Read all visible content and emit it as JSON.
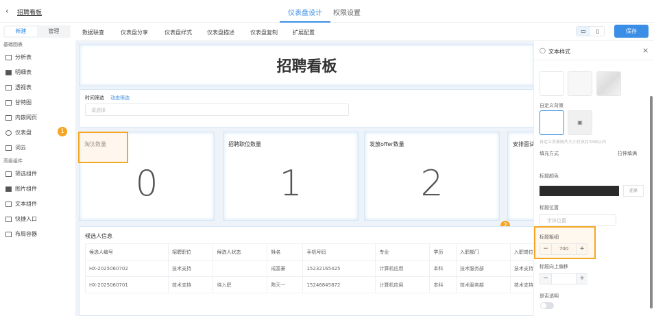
{
  "header": {
    "title": "招聘看板",
    "tabs": [
      "仪表盘设计",
      "权限设置"
    ]
  },
  "sidebar": {
    "seg": [
      "新建",
      "管理"
    ],
    "groups": [
      {
        "label": "基础图表",
        "items": [
          "分析表",
          "明细表",
          "透视表",
          "甘特图",
          "内嵌网页",
          "仪表盘",
          "词云"
        ]
      },
      {
        "label": "高级组件",
        "items": [
          "筛选组件",
          "图片组件",
          "文本组件",
          "快捷入口",
          "布局容器"
        ]
      }
    ]
  },
  "toolbar": {
    "items": [
      "数据联查",
      "仪表盘分享",
      "仪表盘样式",
      "仪表盘描述",
      "仪表盘复制",
      "扩展配置"
    ],
    "save": "保存"
  },
  "canvas": {
    "title": "招聘看板",
    "filter": {
      "label": "时间筛选",
      "dynamic": "动态筛选",
      "placeholder": "请选择"
    },
    "kpis": [
      {
        "label": "淘汰数量",
        "value": "0"
      },
      {
        "label": "招聘职位数量",
        "value": "1"
      },
      {
        "label": "发放offer数量",
        "value": "2"
      },
      {
        "label": "安排面试",
        "value": ""
      }
    ],
    "table": {
      "title": "候选人信息",
      "columns": [
        "候选人编号",
        "招聘职位",
        "候选人状态",
        "姓名",
        "手机号码",
        "专业",
        "学历",
        "入职部门",
        "入职岗位"
      ],
      "rows": [
        [
          "HX-2025060702",
          "技术支持",
          "",
          "成富豪",
          "15232165425",
          "计算机应用",
          "本科",
          "技术服务部",
          "技术支持岗"
        ],
        [
          "HX-2025060701",
          "技术支持",
          "待入职",
          "陈天一",
          "15246845872",
          "计算机应用",
          "本科",
          "技术服务部",
          "技术支持岗"
        ]
      ]
    }
  },
  "badges": [
    "1",
    "2"
  ],
  "panel": {
    "title": "文本样式",
    "custom_bg": "自定义背景",
    "hint": "自定义背景图片大小仅支持3MB以内",
    "fill_label": "填充方式",
    "fill_value": "拉伸填满",
    "color_label": "标题颜色",
    "color_value": "#2b2b2b",
    "reset": "还原",
    "pos_label": "标题位置",
    "pos_placeholder": "字体位置",
    "weight_label": "标题粗细",
    "weight_value": "700",
    "offset_label": "标题向上偏移",
    "offset_value": "",
    "transparent_label": "是否透明",
    "transparent": false
  },
  "colors": {
    "accent": "#3a8ee6",
    "highlight": "#f5a623"
  }
}
